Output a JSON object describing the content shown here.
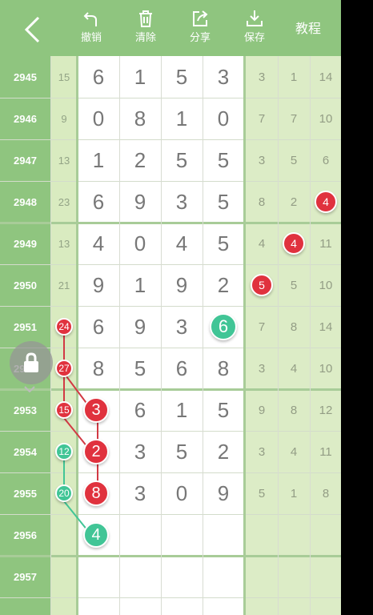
{
  "toolbar": {
    "back_icon": "chevron-left-icon",
    "undo_label": "撤销",
    "clear_label": "清除",
    "share_label": "分享",
    "save_label": "保存",
    "tutorial_label": "教程"
  },
  "colors": {
    "toolbar": "#8fc57f",
    "issue_column": "#8fc57f",
    "sum_column": "#d9ebc0",
    "right_columns": "#dcecc6",
    "red_ball": "#e0323e",
    "green_ball": "#41c596"
  },
  "rows": [
    {
      "issue": "2945",
      "sum": "15",
      "digits": [
        "6",
        "1",
        "5",
        "3"
      ],
      "right": [
        "3",
        "1",
        "14"
      ]
    },
    {
      "issue": "2946",
      "sum": "9",
      "digits": [
        "0",
        "8",
        "1",
        "0"
      ],
      "right": [
        "7",
        "7",
        "10"
      ]
    },
    {
      "issue": "2947",
      "sum": "13",
      "digits": [
        "1",
        "2",
        "5",
        "5"
      ],
      "right": [
        "3",
        "5",
        "6"
      ]
    },
    {
      "issue": "2948",
      "sum": "23",
      "digits": [
        "6",
        "9",
        "3",
        "5"
      ],
      "right": [
        "8",
        "2",
        "4"
      ]
    },
    {
      "issue": "2949",
      "sum": "13",
      "digits": [
        "4",
        "0",
        "4",
        "5"
      ],
      "right": [
        "4",
        "4",
        "11"
      ]
    },
    {
      "issue": "2950",
      "sum": "21",
      "digits": [
        "9",
        "1",
        "9",
        "2"
      ],
      "right": [
        "5",
        "5",
        "10"
      ]
    },
    {
      "issue": "2951",
      "sum": "24",
      "digits": [
        "6",
        "9",
        "3",
        "6"
      ],
      "right": [
        "7",
        "8",
        "14"
      ]
    },
    {
      "issue": "2952",
      "sum": "27",
      "digits": [
        "8",
        "5",
        "6",
        "8"
      ],
      "right": [
        "3",
        "4",
        "10"
      ]
    },
    {
      "issue": "2953",
      "sum": "15",
      "digits": [
        "3",
        "6",
        "1",
        "5"
      ],
      "right": [
        "9",
        "8",
        "12"
      ]
    },
    {
      "issue": "2954",
      "sum": "12",
      "digits": [
        "2",
        "3",
        "5",
        "2"
      ],
      "right": [
        "3",
        "4",
        "11"
      ]
    },
    {
      "issue": "2955",
      "sum": "20",
      "digits": [
        "8",
        "3",
        "0",
        "9"
      ],
      "right": [
        "5",
        "1",
        "8"
      ]
    },
    {
      "issue": "2956",
      "sum": "",
      "digits": [
        "4",
        "",
        "",
        ""
      ],
      "right": [
        "",
        "",
        ""
      ]
    },
    {
      "issue": "2957",
      "sum": "",
      "digits": [
        "",
        "",
        "",
        ""
      ],
      "right": [
        "",
        "",
        ""
      ]
    }
  ],
  "marked": {
    "sum": [
      {
        "row": 6,
        "color": "red"
      },
      {
        "row": 7,
        "color": "red"
      },
      {
        "row": 8,
        "color": "red"
      },
      {
        "row": 9,
        "color": "green"
      },
      {
        "row": 10,
        "color": "green"
      }
    ],
    "digits": [
      {
        "row": 6,
        "col": 3,
        "color": "green"
      },
      {
        "row": 8,
        "col": 0,
        "color": "red"
      },
      {
        "row": 9,
        "col": 0,
        "color": "red"
      },
      {
        "row": 10,
        "col": 0,
        "color": "red"
      },
      {
        "row": 11,
        "col": 0,
        "color": "green"
      }
    ],
    "right": [
      {
        "row": 3,
        "col": 2,
        "color": "red"
      },
      {
        "row": 4,
        "col": 1,
        "color": "red"
      },
      {
        "row": 5,
        "col": 0,
        "color": "red"
      }
    ]
  },
  "lock_icon": "lock-icon"
}
